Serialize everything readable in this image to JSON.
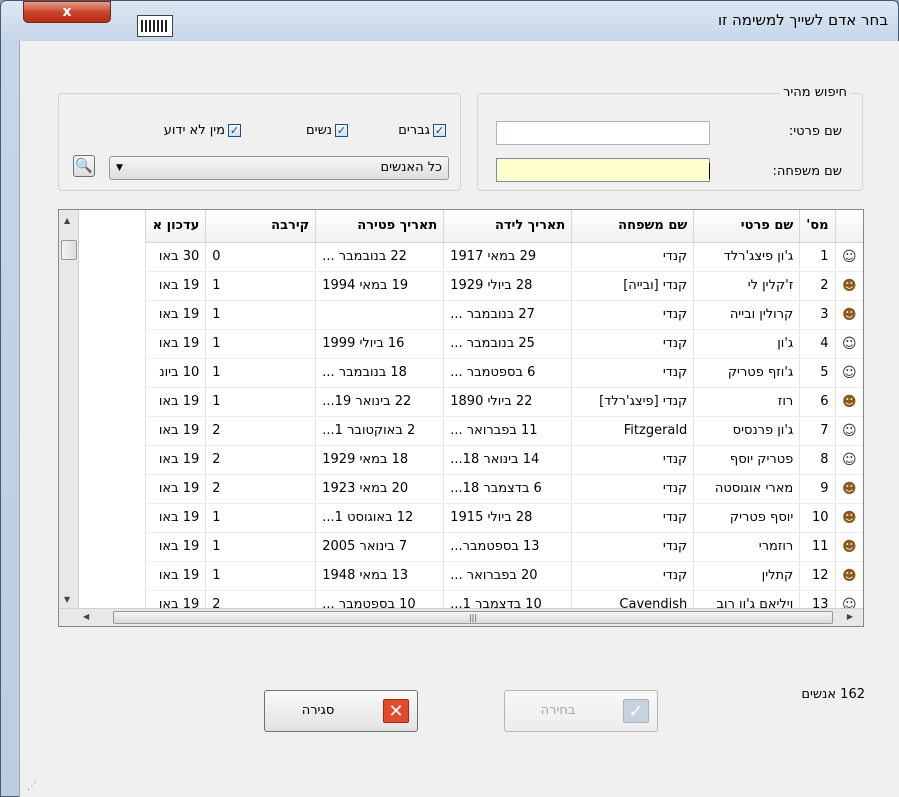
{
  "window": {
    "title": "בחר אדם לשייך למשימה זו",
    "close_label": "x"
  },
  "quick_search": {
    "legend": "חיפוש מהיר",
    "first_name_label": "שם פרטי:",
    "last_name_label": "שם משפחה:",
    "first_name_value": "",
    "last_name_value": ""
  },
  "filters": {
    "men_label": "גברים",
    "women_label": "נשים",
    "unknown_label": "מין לא ידוע",
    "men_checked": "✓",
    "women_checked": "✓",
    "unknown_checked": "✓",
    "combo_value": "כל האנשים"
  },
  "table": {
    "headers": {
      "num": "מס'",
      "first": "שם פרטי",
      "last": "שם משפחה",
      "birth": "תאריך לידה",
      "death": "תאריך פטירה",
      "relation": "קירבה",
      "updated": "עדכון א"
    },
    "rows": [
      {
        "num": "1",
        "icon": "male-icon",
        "first": "ג'ון פיצג'רלד",
        "last": "קנדי",
        "birth": "29 במאי 1917",
        "death": "22 בנובמבר ...",
        "relation": "0",
        "updated": "30 באו"
      },
      {
        "num": "2",
        "icon": "female-icon",
        "first": "ז'קלין לי",
        "last": "קנדי [ובייה]",
        "birth": "28 ביולי 1929",
        "death": "19 במאי 1994",
        "relation": "1",
        "updated": "19 באו"
      },
      {
        "num": "3",
        "icon": "female-icon",
        "first": "קרולין ובייה",
        "last": "קנדי",
        "birth": "27 בנובמבר ...",
        "death": "",
        "relation": "1",
        "updated": "19 באו"
      },
      {
        "num": "4",
        "icon": "male-icon",
        "first": "ג'ון",
        "last": "קנדי",
        "birth": "25 בנובמבר ...",
        "death": "16 ביולי 1999",
        "relation": "1",
        "updated": "19 באו"
      },
      {
        "num": "5",
        "icon": "male-icon",
        "first": "ג'וזף פטריק",
        "last": "קנדי",
        "birth": "6 בספטמבר ...",
        "death": "18 בנובמבר ...",
        "relation": "1",
        "updated": "10 ביונ"
      },
      {
        "num": "6",
        "icon": "female-icon",
        "first": "רוז",
        "last": "קנדי [פיצג'רלד]",
        "birth": "22 ביולי 1890",
        "death": "22 בינואר 19...",
        "relation": "1",
        "updated": "19 באו"
      },
      {
        "num": "7",
        "icon": "male-icon",
        "first": "ג'ון פרנסיס",
        "last": "Fitzgerald",
        "birth": "11 בפברואר ...",
        "death": "2 באוקטובר 1...",
        "relation": "2",
        "updated": "19 באו"
      },
      {
        "num": "8",
        "icon": "male-icon",
        "first": "פטריק יוסף",
        "last": "קנדי",
        "birth": "14 בינואר 18...",
        "death": "18 במאי 1929",
        "relation": "2",
        "updated": "19 באו"
      },
      {
        "num": "9",
        "icon": "female-icon",
        "first": "מארי אוגוסטה",
        "last": "קנדי",
        "birth": "6 בדצמבר 18...",
        "death": "20 במאי 1923",
        "relation": "2",
        "updated": "19 באו"
      },
      {
        "num": "10",
        "icon": "female-icon",
        "first": "יוסף פטריק",
        "last": "קנדי",
        "birth": "28 ביולי 1915",
        "death": "12 באוגוסט 1...",
        "relation": "1",
        "updated": "19 באו"
      },
      {
        "num": "11",
        "icon": "female-icon",
        "first": "רוזמרי",
        "last": "קנדי",
        "birth": "13 בספטמבר...",
        "death": "7 בינואר 2005",
        "relation": "1",
        "updated": "19 באו"
      },
      {
        "num": "12",
        "icon": "female-icon",
        "first": "קתלין",
        "last": "קנדי",
        "birth": "20 בפברואר ...",
        "death": "13 במאי 1948",
        "relation": "1",
        "updated": "19 באו"
      },
      {
        "num": "13",
        "icon": "male-icon",
        "first": "ויליאם ג'ון רוב",
        "last": "Cavendish",
        "birth": "10 בדצמבר 1...",
        "death": "10 בספטמבר ...",
        "relation": "2",
        "updated": "19 באו"
      }
    ]
  },
  "footer": {
    "count_text": "162 אנשים",
    "close_button": "סגירה",
    "select_button": "בחירה"
  },
  "colors": {
    "highlight_field": "#ffffcc",
    "close_icon_bg": "#e14a2a",
    "select_icon_bg": "#c8d2dc"
  }
}
